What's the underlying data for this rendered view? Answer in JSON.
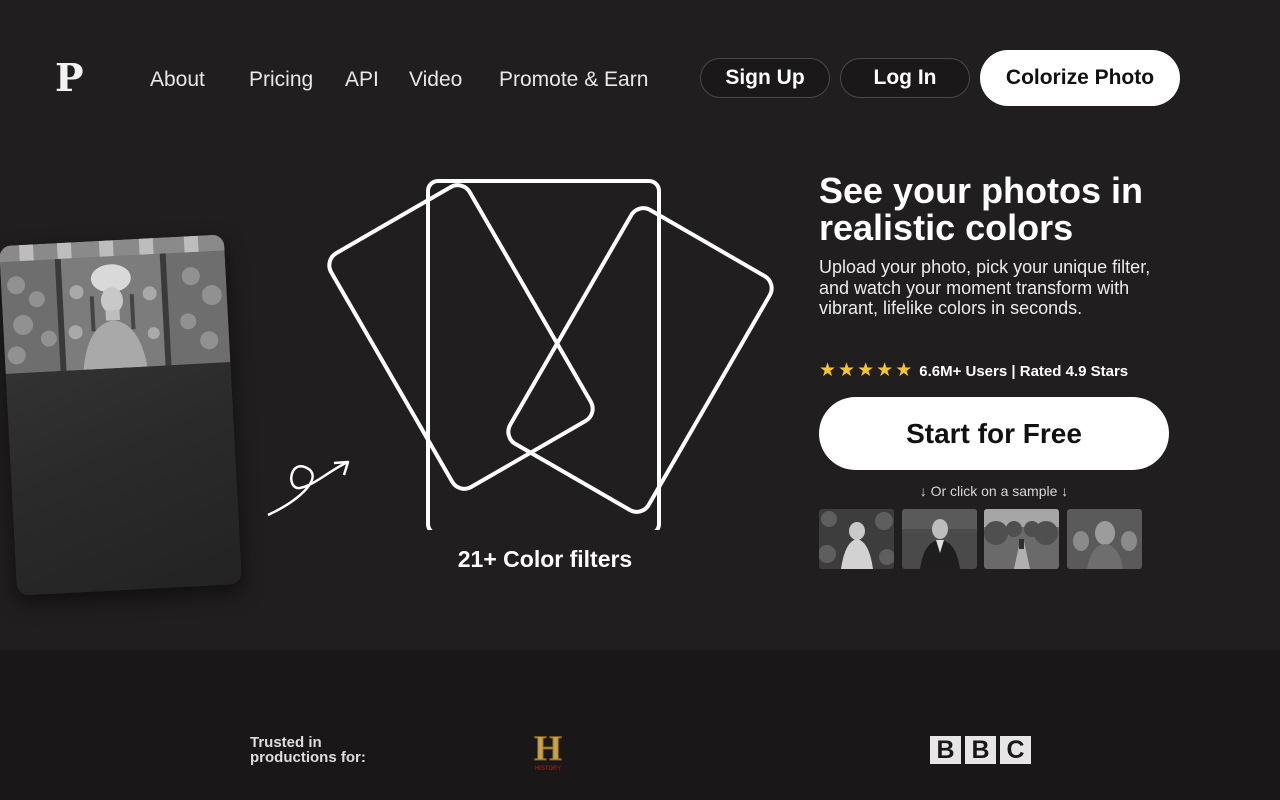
{
  "header": {
    "logo": "P",
    "nav": [
      {
        "label": "About"
      },
      {
        "label": "Pricing"
      },
      {
        "label": "API"
      },
      {
        "label": "Video"
      },
      {
        "label": "Promote & Earn"
      }
    ],
    "signup_label": "Sign Up",
    "login_label": "Log In",
    "colorize_label": "Colorize Photo"
  },
  "illustration": {
    "filters_label": "21+ Color filters"
  },
  "hero": {
    "title": "See your photos in realistic colors",
    "description": "Upload your photo, pick your unique filter, and watch your moment transform with vibrant, lifelike colors in seconds.",
    "stars": 5,
    "rating_text": "6.6M+ Users | Rated 4.9 Stars",
    "cta_label": "Start for Free",
    "sample_hint": "↓ Or click on a sample ↓"
  },
  "trusted": {
    "label": "Trusted in productions for:",
    "logos": {
      "history": "H",
      "history_sub": "HISTORY",
      "bbc": [
        "B",
        "B",
        "C"
      ]
    }
  },
  "colors": {
    "background": "#201e1f",
    "strip": "#191718",
    "star": "#f5c531",
    "button_white": "#ffffff"
  }
}
